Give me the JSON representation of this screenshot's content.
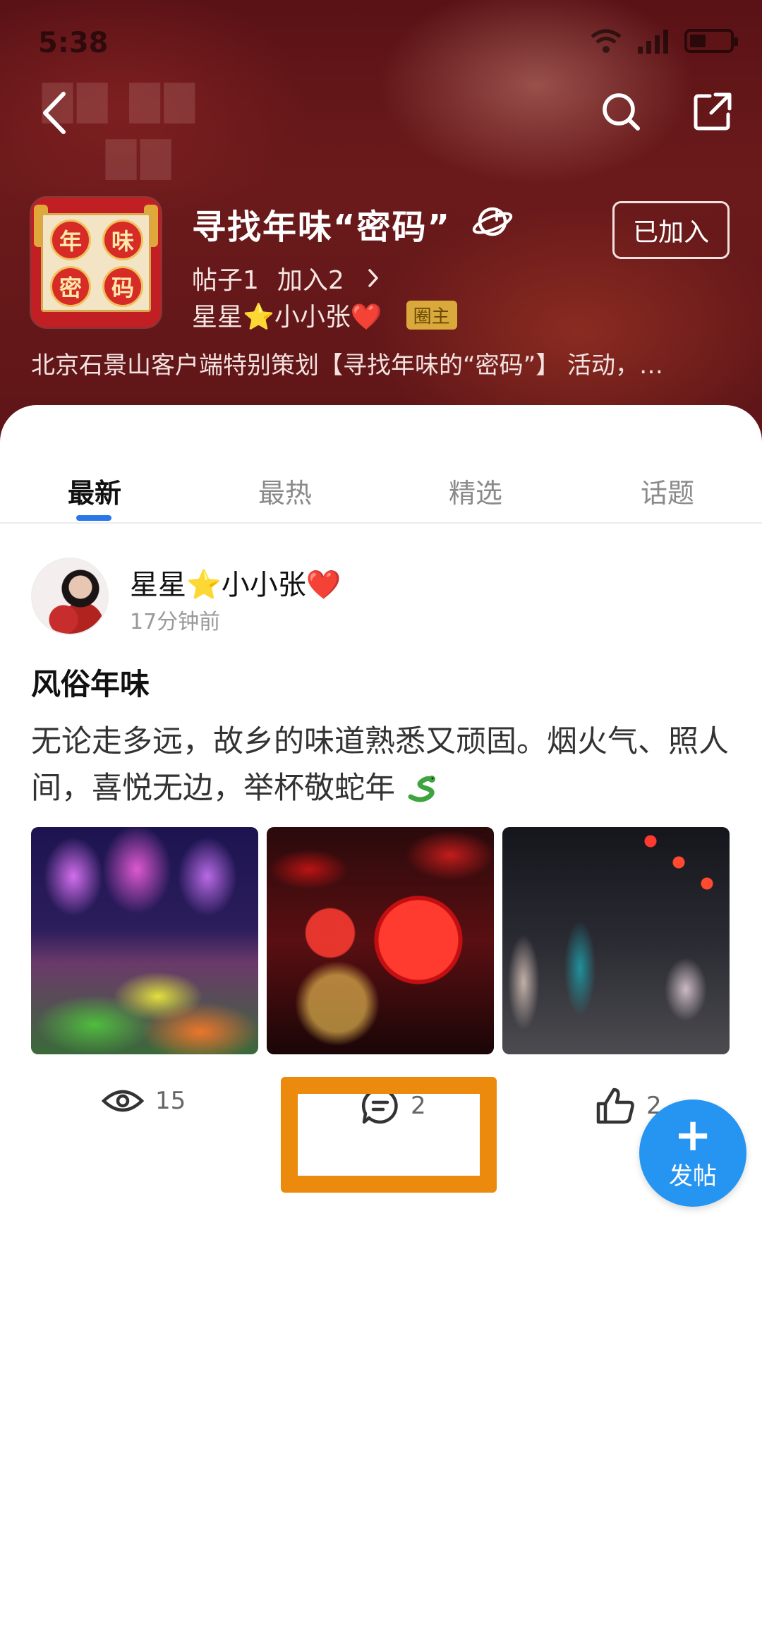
{
  "status_bar": {
    "time": "5:38",
    "icons": [
      "wifi-icon",
      "signal-icon",
      "battery-icon"
    ]
  },
  "nav": {
    "back_icon": "chevron-left-icon",
    "search_icon": "search-icon",
    "share_icon": "share-icon"
  },
  "group": {
    "logo_chars": [
      "年",
      "味",
      "密",
      "码"
    ],
    "title": "寻找年味“密码”",
    "posts_label": "帖子1",
    "members_label": "加入2",
    "owner_name": "星星⭐小小张❤️",
    "owner_badge": "圈主",
    "joined_button": "已加入",
    "description": "北京石景山客户端特别策划【寻找年味的“密码”】 活动，…"
  },
  "tabs": [
    {
      "label": "最新",
      "active": true
    },
    {
      "label": "最热",
      "active": false
    },
    {
      "label": "精选",
      "active": false
    },
    {
      "label": "话题",
      "active": false
    }
  ],
  "post": {
    "author": "星星⭐小小张❤️",
    "time": "17分钟前",
    "title": "风俗年味",
    "body": "无论走多远，故乡的味道熟悉又顽固。烟火气、照人间，喜悦无边，举杯敬蛇年",
    "views": "15",
    "comments": "2",
    "likes": "2"
  },
  "fab": {
    "plus": "+",
    "label": "发帖"
  },
  "colors": {
    "accent_blue": "#2695f2",
    "tab_indicator": "#2a77e8",
    "highlight_orange": "#eb8a0c",
    "header_red": "#6b1a1b",
    "owner_badge_gold": "#d9a93b"
  }
}
